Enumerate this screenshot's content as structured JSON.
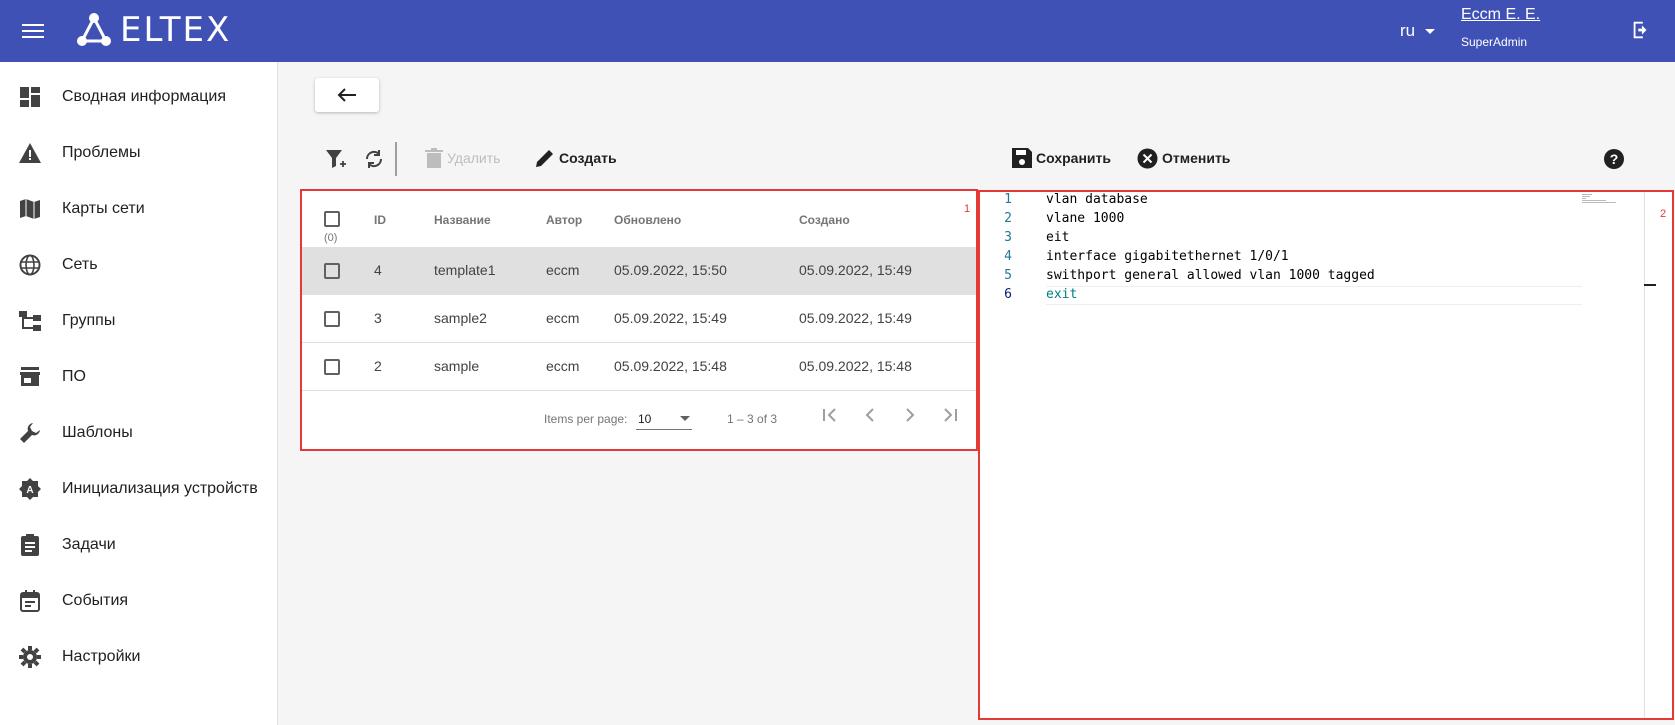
{
  "header": {
    "logo_text": "ELTEX",
    "lang": "ru",
    "user_name": "Eccm E. E.",
    "user_role": "SuperAdmin"
  },
  "sidebar": {
    "items": [
      {
        "label": "Сводная информация",
        "icon": "dashboard-icon"
      },
      {
        "label": "Проблемы",
        "icon": "warning-icon"
      },
      {
        "label": "Карты сети",
        "icon": "map-icon"
      },
      {
        "label": "Сеть",
        "icon": "globe-icon"
      },
      {
        "label": "Группы",
        "icon": "hierarchy-icon"
      },
      {
        "label": "ПО",
        "icon": "store-icon"
      },
      {
        "label": "Шаблоны",
        "icon": "wrench-icon"
      },
      {
        "label": "Инициализация устройств",
        "icon": "init-icon"
      },
      {
        "label": "Задачи",
        "icon": "clipboard-icon"
      },
      {
        "label": "События",
        "icon": "calendar-icon"
      },
      {
        "label": "Настройки",
        "icon": "gear-icon"
      }
    ]
  },
  "toolbar": {
    "delete_label": "Удалить",
    "create_label": "Создать",
    "save_label": "Сохранить",
    "cancel_label": "Отменить"
  },
  "table": {
    "panel_number": "1",
    "columns": [
      "ID",
      "Название",
      "Автор",
      "Обновлено",
      "Создано"
    ],
    "selected_count": "(0)",
    "rows": [
      {
        "id": "4",
        "name": "template1",
        "author": "eccm",
        "updated": "05.09.2022, 15:50",
        "created": "05.09.2022, 15:49"
      },
      {
        "id": "3",
        "name": "sample2",
        "author": "eccm",
        "updated": "05.09.2022, 15:49",
        "created": "05.09.2022, 15:49"
      },
      {
        "id": "2",
        "name": "sample",
        "author": "eccm",
        "updated": "05.09.2022, 15:48",
        "created": "05.09.2022, 15:48"
      }
    ],
    "pager": {
      "items_per_page_label": "Items per page:",
      "items_per_page_value": "10",
      "range": "1 – 3 of 3"
    }
  },
  "editor": {
    "panel_number": "2",
    "lines": [
      {
        "num": "1",
        "text": "vlan database"
      },
      {
        "num": "2",
        "text": "vlane 1000"
      },
      {
        "num": "3",
        "text": "eit"
      },
      {
        "num": "4",
        "text": "interface gigabitethernet 1/0/1"
      },
      {
        "num": "5",
        "text": "swithport general allowed vlan 1000 tagged"
      },
      {
        "num": "6",
        "text": "exit"
      }
    ]
  },
  "colors": {
    "header_bg": "#3f51b5",
    "panel_border": "#e53935",
    "selected_row": "#e0e0e0"
  }
}
